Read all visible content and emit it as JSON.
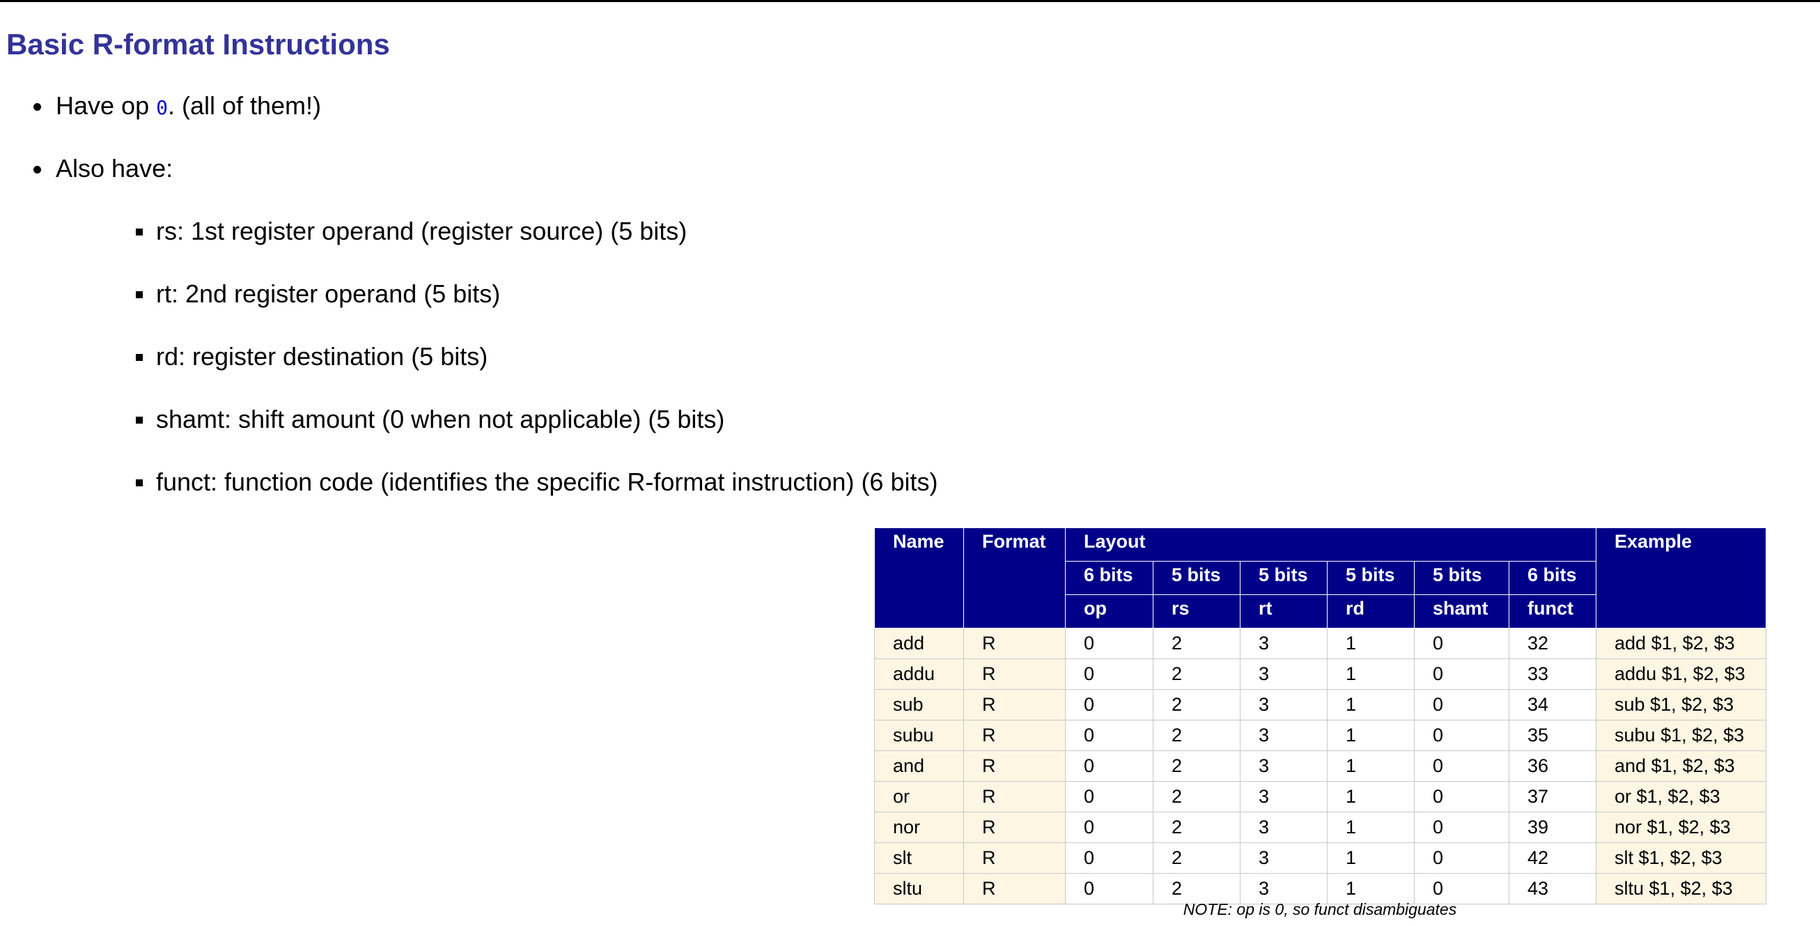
{
  "title": "Basic R-format Instructions",
  "bullets": {
    "op_prefix": "Have op ",
    "op_code": "0",
    "op_suffix": ". (all of them!)",
    "also": "Also have:",
    "fields": [
      "rs: 1st register operand (register source) (5 bits)",
      "rt: 2nd register operand (5 bits)",
      "rd: register destination (5 bits)",
      "shamt: shift amount (0 when not applicable) (5 bits)",
      "funct: function code (identifies the specific R-format instruction) (6 bits)"
    ]
  },
  "table": {
    "headers": {
      "name": "Name",
      "format": "Format",
      "layout": "Layout",
      "example": "Example"
    },
    "bits": [
      "6 bits",
      "5 bits",
      "5 bits",
      "5 bits",
      "5 bits",
      "6 bits"
    ],
    "fields": [
      "op",
      "rs",
      "rt",
      "rd",
      "shamt",
      "funct"
    ],
    "rows": [
      [
        "add",
        "R",
        "0",
        "2",
        "3",
        "1",
        "0",
        "32",
        "add $1, $2, $3"
      ],
      [
        "addu",
        "R",
        "0",
        "2",
        "3",
        "1",
        "0",
        "33",
        "addu $1, $2, $3"
      ],
      [
        "sub",
        "R",
        "0",
        "2",
        "3",
        "1",
        "0",
        "34",
        "sub $1, $2, $3"
      ],
      [
        "subu",
        "R",
        "0",
        "2",
        "3",
        "1",
        "0",
        "35",
        "subu $1, $2, $3"
      ],
      [
        "and",
        "R",
        "0",
        "2",
        "3",
        "1",
        "0",
        "36",
        "and $1, $2, $3"
      ],
      [
        "or",
        "R",
        "0",
        "2",
        "3",
        "1",
        "0",
        "37",
        "or $1, $2, $3"
      ],
      [
        "nor",
        "R",
        "0",
        "2",
        "3",
        "1",
        "0",
        "39",
        "nor $1, $2, $3"
      ],
      [
        "slt",
        "R",
        "0",
        "2",
        "3",
        "1",
        "0",
        "42",
        "slt $1, $2, $3"
      ],
      [
        "sltu",
        "R",
        "0",
        "2",
        "3",
        "1",
        "0",
        "43",
        "sltu $1, $2, $3"
      ]
    ],
    "note": "NOTE: op is 0, so funct disambiguates"
  },
  "colors": {
    "title": "#333399",
    "header_bg": "#000088",
    "shade": "#fdf6e3",
    "code": "#0000cc"
  }
}
